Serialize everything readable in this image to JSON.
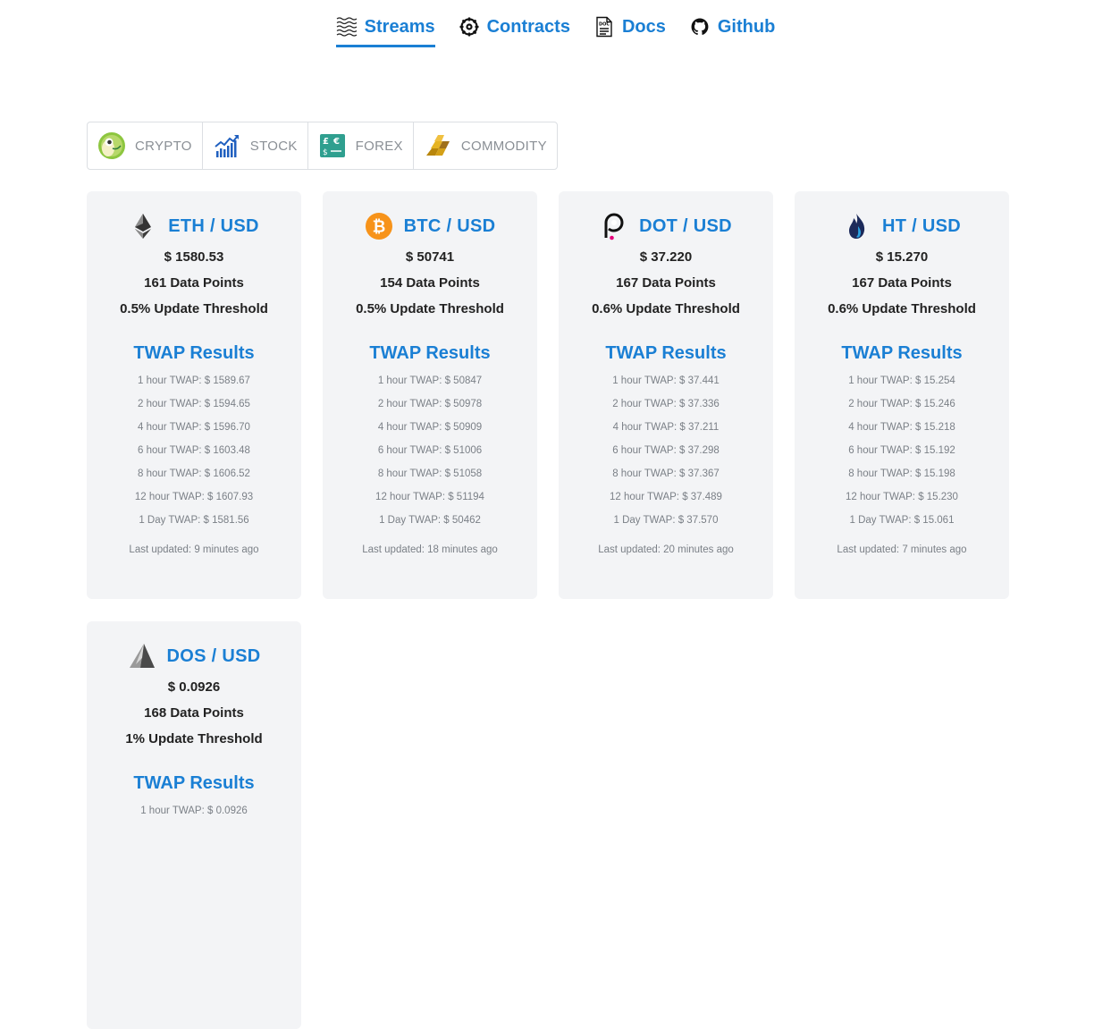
{
  "nav": [
    {
      "label": "Streams",
      "icon": "streams-waves-icon",
      "active": true
    },
    {
      "label": "Contracts",
      "icon": "gear-icon",
      "active": false
    },
    {
      "label": "Docs",
      "icon": "document-icon",
      "active": false
    },
    {
      "label": "Github",
      "icon": "github-icon",
      "active": false
    }
  ],
  "categories": [
    {
      "label": "CRYPTO",
      "icon": "gecko-icon"
    },
    {
      "label": "STOCK",
      "icon": "stock-chart-icon"
    },
    {
      "label": "FOREX",
      "icon": "currency-exchange-icon"
    },
    {
      "label": "COMMODITY",
      "icon": "gold-bars-icon"
    }
  ],
  "colors": {
    "accent": "#1a7fd4",
    "card_bg": "#f3f4f6",
    "muted": "#7b8087"
  },
  "cards": [
    {
      "pair": "ETH / USD",
      "icon": "ethereum-icon",
      "price": "$ 1580.53",
      "data_points": "161 Data Points",
      "threshold": "0.5% Update Threshold",
      "twap_title": "TWAP Results",
      "twap": [
        "1 hour TWAP: $ 1589.67",
        "2 hour TWAP: $ 1594.65",
        "4 hour TWAP: $ 1596.70",
        "6 hour TWAP: $ 1603.48",
        "8 hour TWAP: $ 1606.52",
        "12 hour TWAP: $ 1607.93",
        "1 Day TWAP: $ 1581.56"
      ],
      "updated": "Last updated: 9 minutes ago"
    },
    {
      "pair": "BTC / USD",
      "icon": "bitcoin-icon",
      "price": "$ 50741",
      "data_points": "154 Data Points",
      "threshold": "0.5% Update Threshold",
      "twap_title": "TWAP Results",
      "twap": [
        "1 hour TWAP: $ 50847",
        "2 hour TWAP: $ 50978",
        "4 hour TWAP: $ 50909",
        "6 hour TWAP: $ 51006",
        "8 hour TWAP: $ 51058",
        "12 hour TWAP: $ 51194",
        "1 Day TWAP: $ 50462"
      ],
      "updated": "Last updated: 18 minutes ago"
    },
    {
      "pair": "DOT / USD",
      "icon": "polkadot-icon",
      "price": "$ 37.220",
      "data_points": "167 Data Points",
      "threshold": "0.6% Update Threshold",
      "twap_title": "TWAP Results",
      "twap": [
        "1 hour TWAP: $ 37.441",
        "2 hour TWAP: $ 37.336",
        "4 hour TWAP: $ 37.211",
        "6 hour TWAP: $ 37.298",
        "8 hour TWAP: $ 37.367",
        "12 hour TWAP: $ 37.489",
        "1 Day TWAP: $ 37.570"
      ],
      "updated": "Last updated: 20 minutes ago"
    },
    {
      "pair": "HT / USD",
      "icon": "huobi-flame-icon",
      "price": "$ 15.270",
      "data_points": "167 Data Points",
      "threshold": "0.6% Update Threshold",
      "twap_title": "TWAP Results",
      "twap": [
        "1 hour TWAP: $ 15.254",
        "2 hour TWAP: $ 15.246",
        "4 hour TWAP: $ 15.218",
        "6 hour TWAP: $ 15.192",
        "8 hour TWAP: $ 15.198",
        "12 hour TWAP: $ 15.230",
        "1 Day TWAP: $ 15.061"
      ],
      "updated": "Last updated: 7 minutes ago"
    },
    {
      "pair": "DOS / USD",
      "icon": "dos-pyramid-icon",
      "price": "$ 0.0926",
      "data_points": "168 Data Points",
      "threshold": "1% Update Threshold",
      "twap_title": "TWAP Results",
      "twap": [
        "1 hour TWAP: $ 0.0926"
      ],
      "updated": ""
    }
  ]
}
